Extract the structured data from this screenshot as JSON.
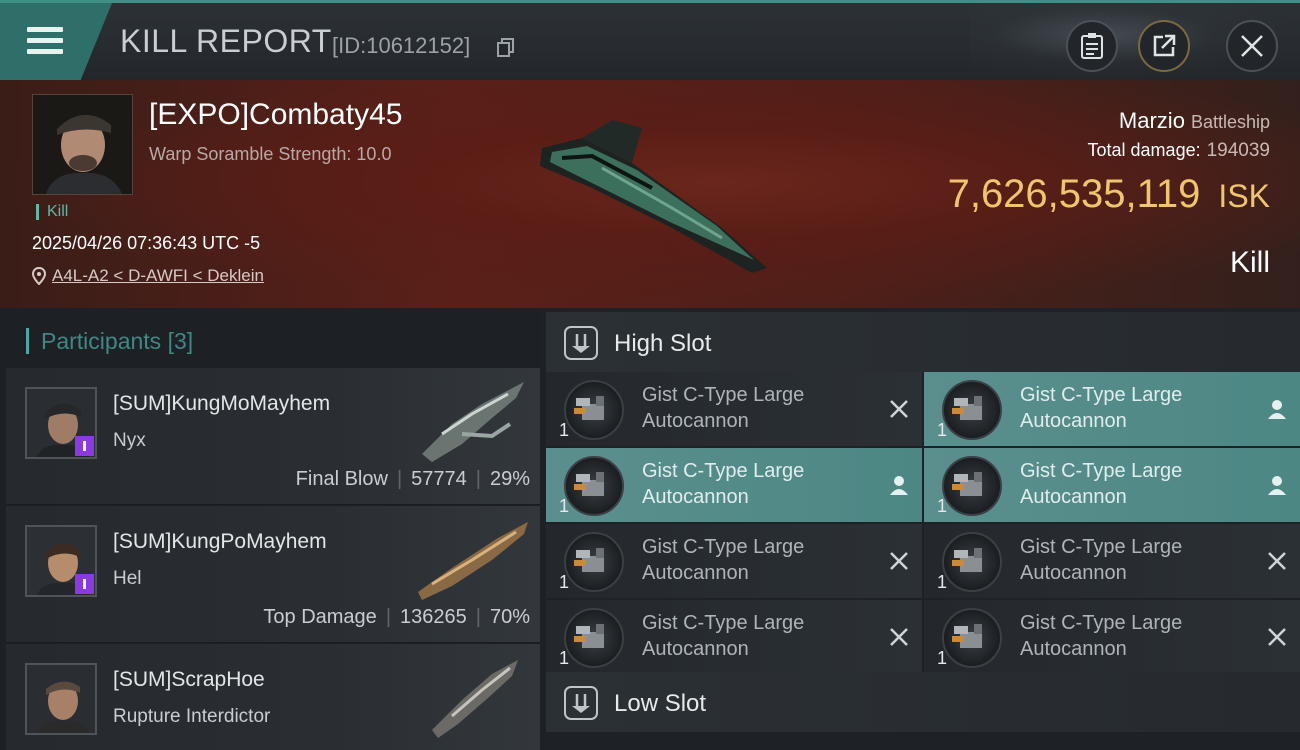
{
  "header": {
    "title": "KILL REPORT",
    "kill_id": "[ID:10612152]",
    "menu_icon": "hamburger-menu-icon",
    "copy_icon": "copy-icon",
    "clipboard_icon": "clipboard-icon",
    "share_icon": "share-icon",
    "close_icon": "close-icon",
    "accent_color": "#3f8f86"
  },
  "victim": {
    "name": "[EXPO]Combaty45",
    "scramble": "Warp Soramble Strength: 10.0",
    "tag": "Kill",
    "timestamp": "2025/04/26 07:36:43 UTC -5",
    "location": "A4L-A2 < D-AWFI < Deklein",
    "ship_name": "Marzio",
    "ship_class": "Battleship",
    "total_damage_label": "Total damage:",
    "total_damage": "194039",
    "isk_value": "7,626,535,119",
    "isk_unit": "ISK",
    "result": "Kill",
    "isk_color": "#f0c66c"
  },
  "participants": {
    "label": "Participants",
    "count": "[3]",
    "rows": [
      {
        "name": "[SUM]KungMoMayhem",
        "ship": "Nyx",
        "stat_label": "Final Blow",
        "damage": "57774",
        "percent": "29%"
      },
      {
        "name": "[SUM]KungPoMayhem",
        "ship": "Hel",
        "stat_label": "Top Damage",
        "damage": "136265",
        "percent": "70%"
      },
      {
        "name": "[SUM]ScrapHoe",
        "ship": "Rupture Interdictor"
      }
    ]
  },
  "slots": {
    "high": {
      "label": "High Slot",
      "modules": [
        {
          "name_line1": "Gist C-Type Large",
          "name_line2": "Autocannon",
          "qty": "1",
          "state": "destroyed"
        },
        {
          "name_line1": "Gist C-Type Large",
          "name_line2": "Autocannon",
          "qty": "1",
          "state": "dropped"
        },
        {
          "name_line1": "Gist C-Type Large",
          "name_line2": "Autocannon",
          "qty": "1",
          "state": "dropped"
        },
        {
          "name_line1": "Gist C-Type Large",
          "name_line2": "Autocannon",
          "qty": "1",
          "state": "dropped"
        },
        {
          "name_line1": "Gist C-Type Large",
          "name_line2": "Autocannon",
          "qty": "1",
          "state": "destroyed"
        },
        {
          "name_line1": "Gist C-Type Large",
          "name_line2": "Autocannon",
          "qty": "1",
          "state": "destroyed"
        },
        {
          "name_line1": "Gist C-Type Large",
          "name_line2": "Autocannon",
          "qty": "1",
          "state": "destroyed"
        },
        {
          "name_line1": "Gist C-Type Large",
          "name_line2": "Autocannon",
          "qty": "1",
          "state": "destroyed"
        }
      ]
    },
    "low": {
      "label": "Low Slot"
    }
  }
}
